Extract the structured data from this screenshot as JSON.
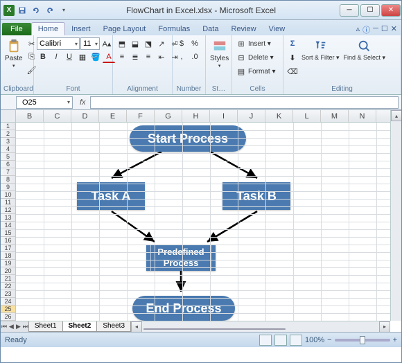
{
  "window": {
    "title": "FlowChart in Excel.xlsx - Microsoft Excel"
  },
  "tabs": {
    "file": "File",
    "items": [
      "Home",
      "Insert",
      "Page Layout",
      "Formulas",
      "Data",
      "Review",
      "View"
    ],
    "active": "Home"
  },
  "ribbon": {
    "clipboard": {
      "label": "Clipboard",
      "paste": "Paste"
    },
    "font": {
      "label": "Font",
      "name": "Calibri",
      "size": "11"
    },
    "alignment": {
      "label": "Alignment"
    },
    "number": {
      "label": "Number"
    },
    "styles": {
      "label": "St…",
      "btn": "Styles"
    },
    "cells": {
      "label": "Cells",
      "insert": "Insert ▾",
      "delete": "Delete ▾",
      "format": "Format ▾"
    },
    "editing": {
      "label": "Editing",
      "sort": "Sort & Filter ▾",
      "find": "Find & Select ▾"
    }
  },
  "formulabar": {
    "namebox": "O25",
    "fx": "fx"
  },
  "grid": {
    "cols": [
      "B",
      "C",
      "D",
      "E",
      "F",
      "G",
      "H",
      "I",
      "J",
      "K",
      "L",
      "M",
      "N"
    ],
    "rowCount": 27,
    "selectedRow": 25
  },
  "sheets": {
    "nav": [
      "⏮",
      "◀",
      "▶",
      "⏭"
    ],
    "items": [
      "Sheet1",
      "Sheet2",
      "Sheet3"
    ],
    "active": "Sheet2"
  },
  "flowchart": {
    "start": "Start Process",
    "taskA": "Task A",
    "taskB": "Task B",
    "predef": "Predefined Process",
    "end": "End Process"
  },
  "status": {
    "ready": "Ready",
    "zoom": "100%",
    "minus": "−",
    "plus": "+"
  }
}
